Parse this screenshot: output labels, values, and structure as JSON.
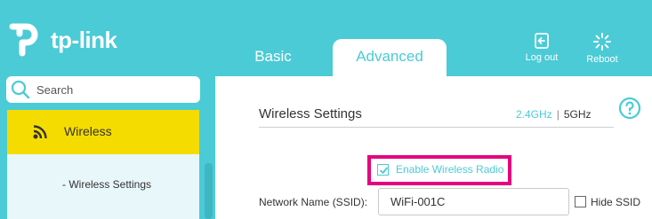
{
  "brand": {
    "name": "tp-link",
    "header_color": "#4acbd6",
    "highlight_color": "#e6007e",
    "menu_active_color": "#f5dc00"
  },
  "tabs": [
    {
      "label": "Basic",
      "active": false
    },
    {
      "label": "Advanced",
      "active": true
    }
  ],
  "header_actions": {
    "logout": {
      "label": "Log out",
      "icon": "logout-icon"
    },
    "reboot": {
      "label": "Reboot",
      "icon": "reboot-icon"
    }
  },
  "sidebar": {
    "search": {
      "placeholder": "Search",
      "value": ""
    },
    "active_item": {
      "label": "Wireless",
      "icon": "wifi-icon"
    },
    "subitems": [
      {
        "label": "- Wireless Settings"
      }
    ]
  },
  "main": {
    "section_title": "Wireless Settings",
    "bands": {
      "band_24": "2.4GHz",
      "separator": "|",
      "band_5": "5GHz",
      "active": "2.4GHz"
    },
    "enable_radio": {
      "label": "Enable Wireless Radio",
      "checked": true
    },
    "ssid": {
      "label": "Network Name (SSID):",
      "value": "WiFi-001C"
    },
    "hide_ssid": {
      "label": "Hide SSID",
      "checked": false
    }
  }
}
